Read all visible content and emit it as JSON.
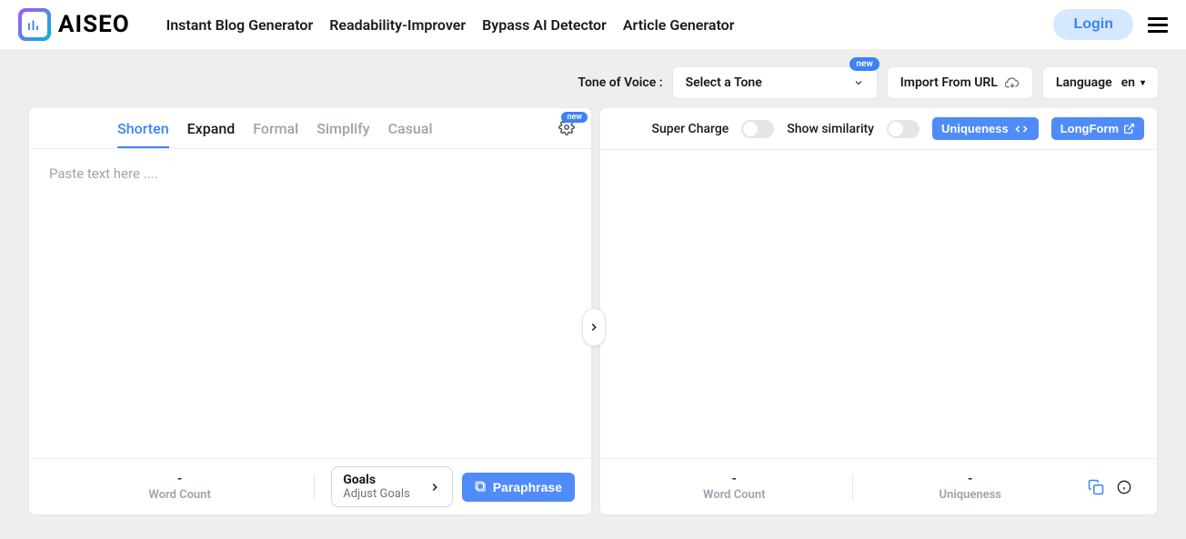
{
  "header": {
    "logo_text": "AISEO",
    "nav": [
      "Instant Blog Generator",
      "Readability-Improver",
      "Bypass AI Detector",
      "Article Generator"
    ],
    "login_label": "Login"
  },
  "toolbar": {
    "tone_label": "Tone of Voice :",
    "tone_placeholder": "Select a Tone",
    "new_badge": "new",
    "import_label": "Import From URL",
    "language_label": "Language",
    "language_value": "en"
  },
  "left_panel": {
    "tabs": [
      "Shorten",
      "Expand",
      "Formal",
      "Simplify",
      "Casual"
    ],
    "gear_new": "new",
    "textarea_placeholder": "Paste text here ....",
    "word_count_value": "-",
    "word_count_label": "Word Count",
    "goals_title": "Goals",
    "goals_sub": "Adjust Goals",
    "paraphrase_label": "Paraphrase"
  },
  "right_panel": {
    "supercharge_label": "Super Charge",
    "similarity_label": "Show similarity",
    "uniqueness_btn": "Uniqueness",
    "longform_btn": "LongForm",
    "word_count_value": "-",
    "word_count_label": "Word Count",
    "uniqueness_value": "-",
    "uniqueness_label": "Uniqueness"
  }
}
